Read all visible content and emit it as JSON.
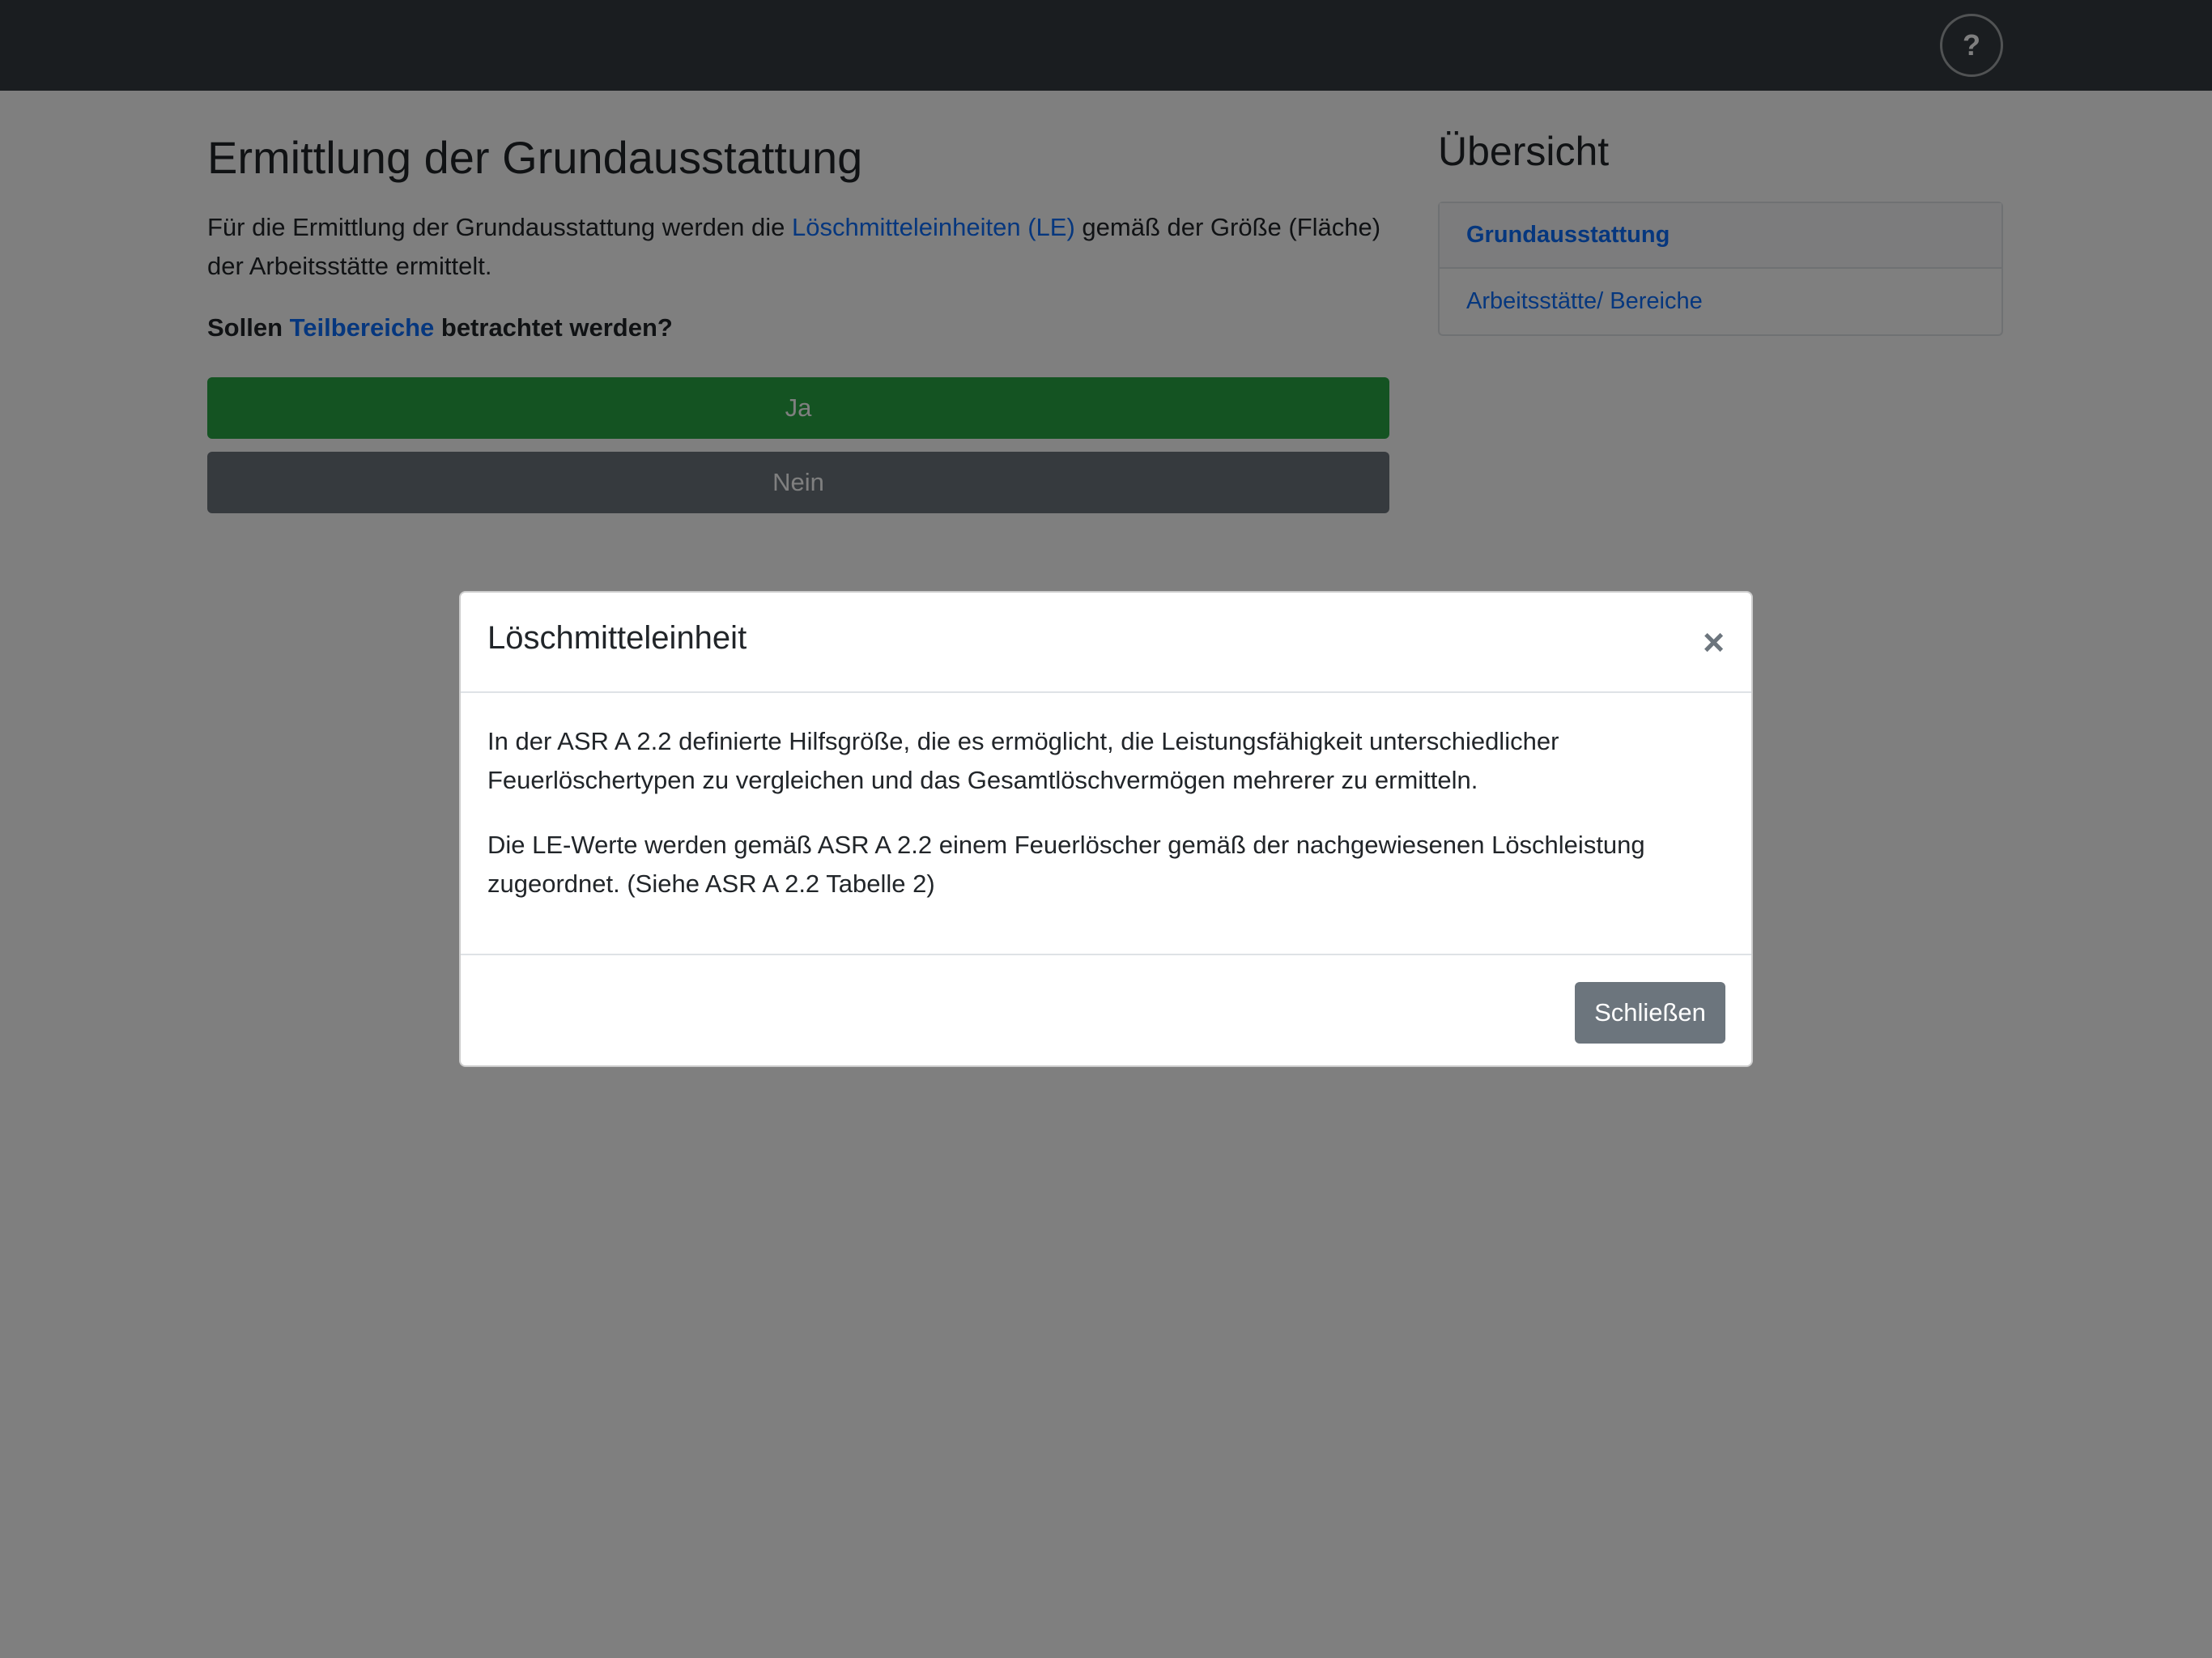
{
  "navbar": {
    "help_label": "?"
  },
  "main": {
    "title": "Ermittlung der Grundausstattung",
    "intro_before": "Für die Ermittlung der Grundausstattung werden die ",
    "intro_link": "Löschmitteleinheiten (LE)",
    "intro_after": " gemäß der Größe (Fläche) der Arbeitsstätte ermittelt.",
    "question_before": "Sollen ",
    "question_link": "Teilbereiche",
    "question_after": " betrachtet werden?",
    "yes_label": "Ja",
    "no_label": "Nein"
  },
  "sidebar": {
    "title": "Übersicht",
    "items": [
      {
        "label": "Grundausstattung"
      },
      {
        "label": "Arbeitsstätte/ Bereiche"
      }
    ]
  },
  "modal": {
    "title": "Löschmitteleinheit",
    "close_symbol": "×",
    "paragraph1": "In der ASR A 2.2 definierte Hilfsgröße, die es ermöglicht, die Leistungsfähigkeit unterschiedlicher Feuerlöschertypen zu vergleichen und das Gesamtlöschvermögen mehrerer zu ermitteln.",
    "paragraph2": "Die LE-Werte werden gemäß ASR A 2.2 einem Feuerlöscher gemäß der nachgewiesenen Löschleistung zugeordnet. (Siehe ASR A 2.2 Tabelle 2)",
    "close_button_label": "Schließen"
  }
}
